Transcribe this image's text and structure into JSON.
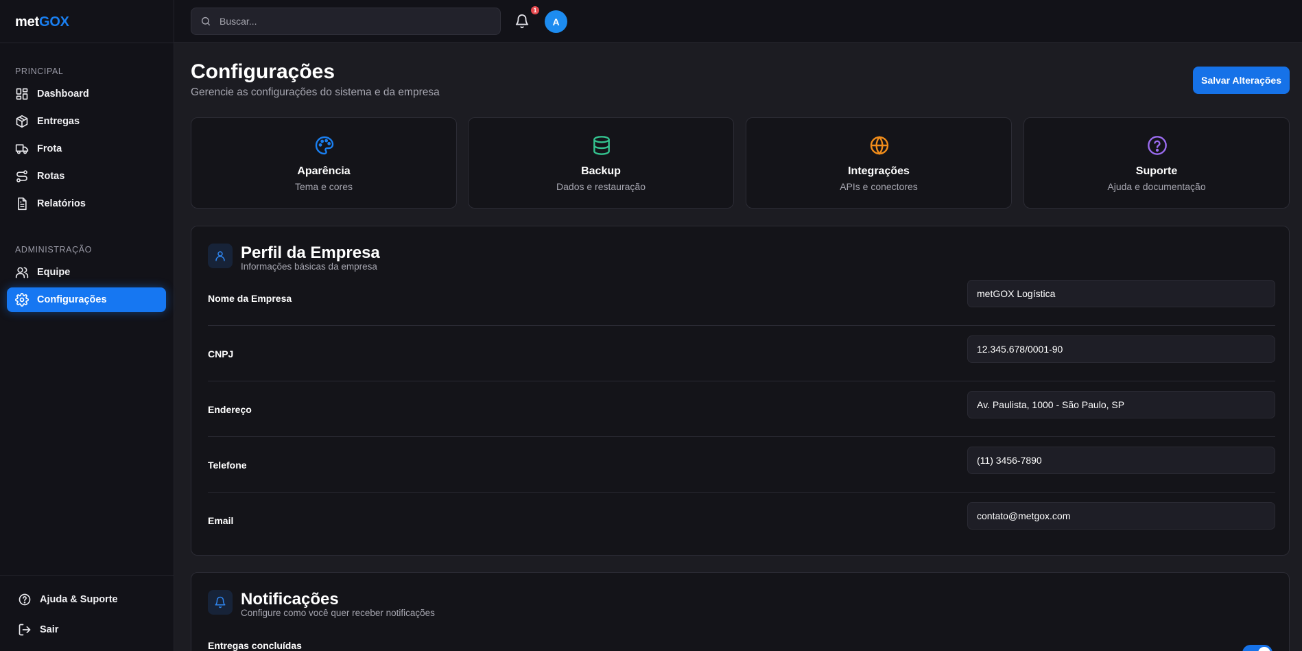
{
  "brand": {
    "part1": "met",
    "part2": "GOX"
  },
  "sidebar": {
    "section_principal": "PRINCIPAL",
    "section_admin": "ADMINISTRAÇÃO",
    "items": [
      {
        "label": "Dashboard",
        "icon": "dashboard-icon"
      },
      {
        "label": "Entregas",
        "icon": "package-icon"
      },
      {
        "label": "Frota",
        "icon": "truck-icon"
      },
      {
        "label": "Rotas",
        "icon": "route-icon"
      },
      {
        "label": "Relatórios",
        "icon": "report-icon"
      },
      {
        "label": "Equipe",
        "icon": "users-icon"
      },
      {
        "label": "Configurações",
        "icon": "gear-icon",
        "active": true
      }
    ],
    "help_label": "Ajuda & Suporte",
    "logout_label": "Sair"
  },
  "header": {
    "search_placeholder": "Buscar...",
    "notification_count": "1",
    "avatar_initial": "A"
  },
  "page": {
    "title": "Configurações",
    "subtitle": "Gerencie as configurações do sistema e da empresa",
    "save_label": "Salvar Alterações"
  },
  "quick_cards": [
    {
      "title": "Aparência",
      "subtitle": "Tema e cores",
      "icon": "palette-icon",
      "color": "#1a7ff0"
    },
    {
      "title": "Backup",
      "subtitle": "Dados e restauração",
      "icon": "database-icon",
      "color": "#34c38f"
    },
    {
      "title": "Integrações",
      "subtitle": "APIs e conectores",
      "icon": "globe-icon",
      "color": "#f08c1a"
    },
    {
      "title": "Suporte",
      "subtitle": "Ajuda e documentação",
      "icon": "help-circle-icon",
      "color": "#9b6cf0"
    }
  ],
  "company_profile": {
    "title": "Perfil da Empresa",
    "subtitle": "Informações básicas da empresa",
    "fields": [
      {
        "label": "Nome da Empresa",
        "value": "metGOX Logística"
      },
      {
        "label": "CNPJ",
        "value": "12.345.678/0001-90"
      },
      {
        "label": "Endereço",
        "value": "Av. Paulista, 1000 - São Paulo, SP"
      },
      {
        "label": "Telefone",
        "value": "(11) 3456-7890"
      },
      {
        "label": "Email",
        "value": "contato@metgox.com"
      }
    ]
  },
  "notifications": {
    "title": "Notificações",
    "subtitle": "Configure como você quer receber notificações",
    "items": [
      {
        "label": "Entregas concluídas",
        "enabled": true
      }
    ]
  },
  "colors": {
    "accent": "#1672e8",
    "background": "#1c1c22",
    "sidebar": "#121218",
    "card": "#141419"
  }
}
